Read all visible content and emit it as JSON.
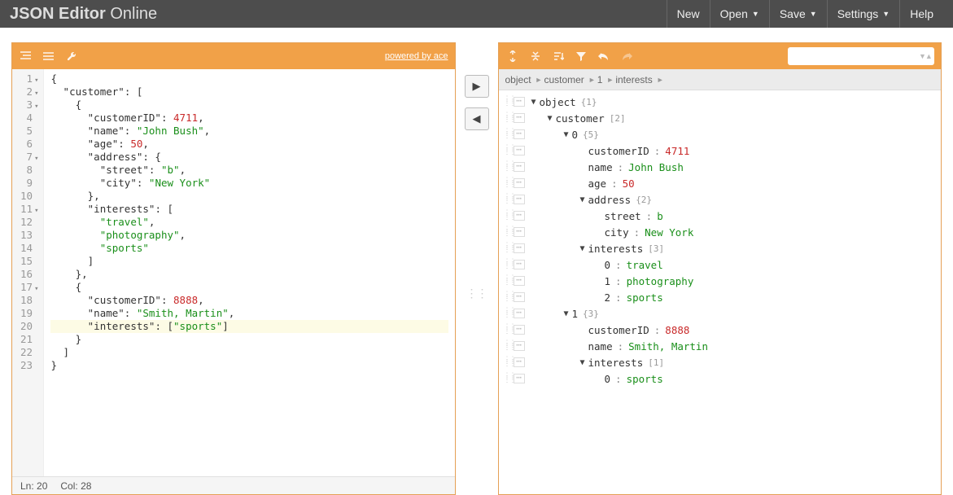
{
  "header": {
    "title_bold": "JSON Editor",
    "title_light": "Online",
    "menu": {
      "new": "New",
      "open": "Open",
      "save": "Save",
      "settings": "Settings",
      "help": "Help"
    }
  },
  "left_panel": {
    "powered_by": "powered by ace",
    "status": {
      "line_label": "Ln:",
      "line": "20",
      "col_label": "Col:",
      "col": "28"
    },
    "code_lines": [
      {
        "n": "1",
        "fold": true,
        "text": "{"
      },
      {
        "n": "2",
        "fold": true,
        "text": "  \"customer\": ["
      },
      {
        "n": "3",
        "fold": true,
        "text": "    {"
      },
      {
        "n": "4",
        "fold": false,
        "text": "      \"customerID\": 4711,"
      },
      {
        "n": "5",
        "fold": false,
        "text": "      \"name\": \"John Bush\","
      },
      {
        "n": "6",
        "fold": false,
        "text": "      \"age\": 50,"
      },
      {
        "n": "7",
        "fold": true,
        "text": "      \"address\": {"
      },
      {
        "n": "8",
        "fold": false,
        "text": "        \"street\": \"b\","
      },
      {
        "n": "9",
        "fold": false,
        "text": "        \"city\": \"New York\""
      },
      {
        "n": "10",
        "fold": false,
        "text": "      },"
      },
      {
        "n": "11",
        "fold": true,
        "text": "      \"interests\": ["
      },
      {
        "n": "12",
        "fold": false,
        "text": "        \"travel\","
      },
      {
        "n": "13",
        "fold": false,
        "text": "        \"photography\","
      },
      {
        "n": "14",
        "fold": false,
        "text": "        \"sports\""
      },
      {
        "n": "15",
        "fold": false,
        "text": "      ]"
      },
      {
        "n": "16",
        "fold": false,
        "text": "    },"
      },
      {
        "n": "17",
        "fold": true,
        "text": "    {"
      },
      {
        "n": "18",
        "fold": false,
        "text": "      \"customerID\": 8888,"
      },
      {
        "n": "19",
        "fold": false,
        "text": "      \"name\": \"Smith, Martin\","
      },
      {
        "n": "20",
        "fold": false,
        "text": "      \"interests\": [\"sports\"]",
        "hl": true
      },
      {
        "n": "21",
        "fold": false,
        "text": "    }"
      },
      {
        "n": "22",
        "fold": false,
        "text": "  ]"
      },
      {
        "n": "23",
        "fold": false,
        "text": "}"
      }
    ]
  },
  "right_panel": {
    "search_placeholder": "",
    "breadcrumb": [
      "object",
      "customer",
      "1",
      "interests"
    ],
    "tree": [
      {
        "indent": 0,
        "caret": "down",
        "key": "object",
        "meta": "{1}"
      },
      {
        "indent": 1,
        "caret": "down",
        "key": "customer",
        "meta": "[2]"
      },
      {
        "indent": 2,
        "caret": "down",
        "key": "0",
        "meta": "{5}"
      },
      {
        "indent": 3,
        "caret": "none",
        "key": "customerID",
        "sep": ":",
        "val": "4711",
        "vtype": "num"
      },
      {
        "indent": 3,
        "caret": "none",
        "key": "name",
        "sep": ":",
        "val": "John Bush",
        "vtype": "str"
      },
      {
        "indent": 3,
        "caret": "none",
        "key": "age",
        "sep": ":",
        "val": "50",
        "vtype": "num"
      },
      {
        "indent": 3,
        "caret": "down",
        "key": "address",
        "meta": "{2}"
      },
      {
        "indent": 4,
        "caret": "none",
        "key": "street",
        "sep": ":",
        "val": "b",
        "vtype": "str"
      },
      {
        "indent": 4,
        "caret": "none",
        "key": "city",
        "sep": ":",
        "val": "New York",
        "vtype": "str"
      },
      {
        "indent": 3,
        "caret": "down",
        "key": "interests",
        "meta": "[3]"
      },
      {
        "indent": 4,
        "caret": "none",
        "key": "0",
        "sep": ":",
        "val": "travel",
        "vtype": "str"
      },
      {
        "indent": 4,
        "caret": "none",
        "key": "1",
        "sep": ":",
        "val": "photography",
        "vtype": "str"
      },
      {
        "indent": 4,
        "caret": "none",
        "key": "2",
        "sep": ":",
        "val": "sports",
        "vtype": "str"
      },
      {
        "indent": 2,
        "caret": "down",
        "key": "1",
        "meta": "{3}"
      },
      {
        "indent": 3,
        "caret": "none",
        "key": "customerID",
        "sep": ":",
        "val": "8888",
        "vtype": "num"
      },
      {
        "indent": 3,
        "caret": "none",
        "key": "name",
        "sep": ":",
        "val": "Smith, Martin",
        "vtype": "str"
      },
      {
        "indent": 3,
        "caret": "down",
        "key": "interests",
        "meta": "[1]"
      },
      {
        "indent": 4,
        "caret": "none",
        "key": "0",
        "sep": ":",
        "val": "sports",
        "vtype": "str"
      }
    ]
  }
}
